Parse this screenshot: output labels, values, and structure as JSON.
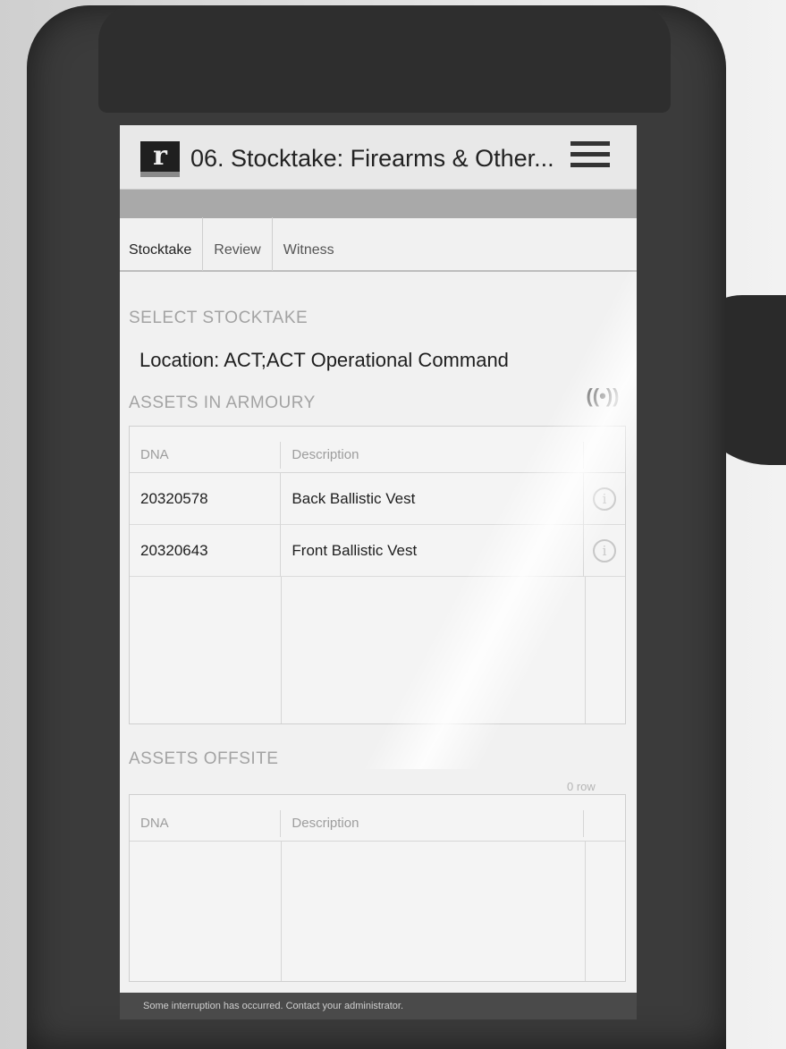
{
  "app": {
    "logo_letter": "r",
    "title": "06. Stocktake: Firearms & Other...",
    "menu_icon": "hamburger-menu-icon"
  },
  "tabs": [
    {
      "label": "Stocktake",
      "active": true
    },
    {
      "label": "Review",
      "active": false
    },
    {
      "label": "Witness",
      "active": false
    }
  ],
  "select_stocktake": {
    "heading": "SELECT STOCKTAKE",
    "location": "Location: ACT;ACT Operational Command"
  },
  "assets_in_armoury": {
    "heading": "ASSETS IN ARMOURY",
    "rfid_icon": "rfid-scan-icon",
    "rfid_glyph": "((•))",
    "columns": {
      "dna": "DNA",
      "description": "Description"
    },
    "rows": [
      {
        "dna": "20320578",
        "description": "Back Ballistic Vest",
        "action_icon": "info-icon"
      },
      {
        "dna": "20320643",
        "description": "Front Ballistic Vest",
        "action_icon": "info-icon"
      }
    ]
  },
  "assets_offsite": {
    "heading": "ASSETS OFFSITE",
    "count_label": "0 row",
    "columns": {
      "dna": "DNA",
      "description": "Description"
    },
    "rows": []
  },
  "footer": {
    "message": "Some interruption has occurred. Contact your administrator."
  },
  "colors": {
    "header_bg": "#e8e8e8",
    "status_bar": "#a9a9a9",
    "footer_bg": "#4a4a4a"
  }
}
